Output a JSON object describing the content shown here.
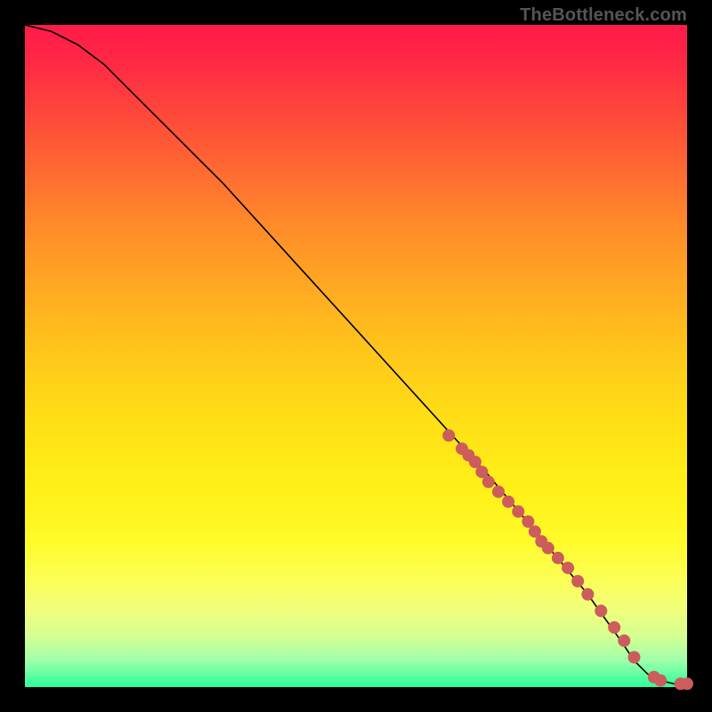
{
  "watermark": "TheBottleneck.com",
  "chart_data": {
    "type": "line",
    "title": "",
    "xlabel": "",
    "ylabel": "",
    "xlim": [
      0,
      100
    ],
    "ylim": [
      0,
      100
    ],
    "curve": {
      "x": [
        0,
        4,
        8,
        12,
        16,
        20,
        30,
        40,
        50,
        60,
        70,
        80,
        85,
        90,
        92,
        94,
        96,
        98,
        100
      ],
      "y": [
        100,
        99,
        97,
        94,
        90,
        86,
        76,
        65,
        54,
        43,
        32,
        20,
        14,
        7,
        4,
        2,
        1,
        0.5,
        0.5
      ]
    },
    "markers": {
      "x": [
        64,
        66,
        67,
        68,
        69,
        70,
        71.5,
        73,
        74.5,
        76,
        77,
        78,
        79,
        80.5,
        82,
        83.5,
        85,
        87,
        89,
        90.5,
        92,
        95,
        96,
        99,
        100
      ],
      "y": [
        38,
        36,
        35,
        34,
        32.5,
        31,
        29.5,
        28,
        26.5,
        25,
        23.5,
        22,
        21,
        19.5,
        18,
        16,
        14,
        11.5,
        9,
        7,
        4.5,
        1.5,
        1,
        0.5,
        0.5
      ]
    }
  }
}
